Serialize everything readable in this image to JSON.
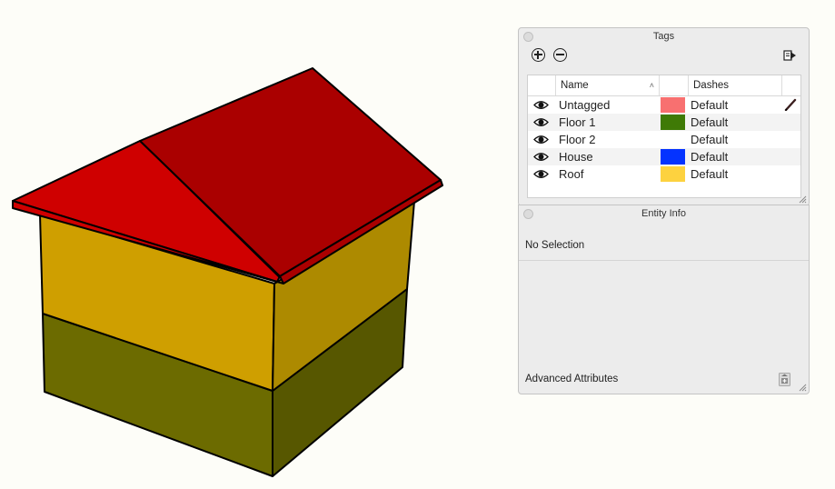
{
  "tags_panel": {
    "title": "Tags",
    "columns": {
      "name": "Name",
      "dashes": "Dashes"
    },
    "rows": [
      {
        "name": "Untagged",
        "color": "#f87070",
        "dashes": "Default",
        "visible": true
      },
      {
        "name": "Floor 1",
        "color": "#3f7a06",
        "dashes": "Default",
        "visible": true
      },
      {
        "name": "Floor 2",
        "color": "",
        "dashes": "Default",
        "visible": true
      },
      {
        "name": "House",
        "color": "#0433ff",
        "dashes": "Default",
        "visible": true
      },
      {
        "name": "Roof",
        "color": "#fdd23f",
        "dashes": "Default",
        "visible": true
      }
    ]
  },
  "entity_panel": {
    "title": "Entity Info",
    "selection": "No Selection",
    "advanced": "Advanced Attributes"
  },
  "model": {
    "face_colors": {
      "roof_left": "#cf0000",
      "roof_right": "#aa0000",
      "floor2_front": "#cf9f00",
      "floor2_side": "#ad8a00",
      "floor1_front": "#6c6b00",
      "floor1_side": "#575700"
    }
  },
  "icons": {
    "add": "plus-circle-icon",
    "remove": "minus-circle-icon",
    "export": "export-arrow-icon",
    "visibility": "eye-icon",
    "pencil": "pencil-icon",
    "advanced_toggle": "expand-icon",
    "resize": "resize-grip-icon"
  }
}
